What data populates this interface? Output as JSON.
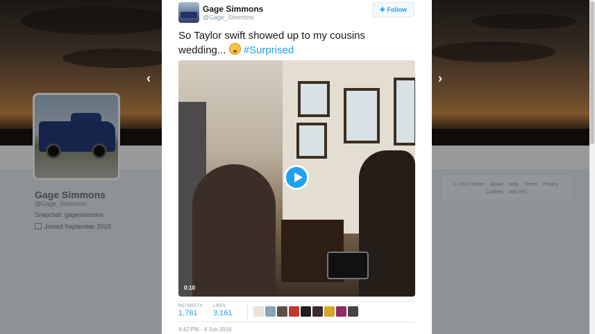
{
  "profile": {
    "name": "Gage Simmons",
    "handle": "@Gage_Simmons",
    "bio": "Snapchat: gagesimmons",
    "joined": "Joined September 2010"
  },
  "footer": {
    "links": [
      "© 2016 Twitter",
      "About",
      "Help",
      "Terms",
      "Privacy",
      "Cookies",
      "Ads info"
    ]
  },
  "navigation": {
    "prev_icon": "chevron-left-icon",
    "next_icon": "chevron-right-icon"
  },
  "tweet": {
    "author_name": "Gage Simmons",
    "author_handle": "@Gage_Simmons",
    "follow_label": "Follow",
    "text": "So Taylor swift showed up to my cousins wedding... ",
    "emoji": "flushed-face-emoji",
    "hashtag": "#Surprised",
    "video": {
      "duration": "0:10"
    },
    "stats": {
      "retweets_label": "RETWEETS",
      "retweets_value": "1,781",
      "likes_label": "LIKES",
      "likes_value": "3,161"
    },
    "likers_count_shown": 9,
    "timestamp": "4:42 PM - 4 Jun 2016"
  },
  "colors": {
    "accent": "#1da1f2",
    "text": "#14171a",
    "muted": "#8899a6"
  }
}
